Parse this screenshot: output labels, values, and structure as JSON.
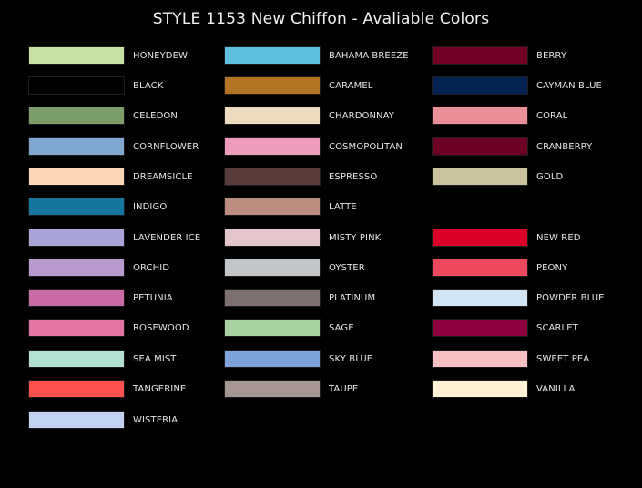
{
  "title": "STYLE 1153 New Chiffon - Avaliable Colors",
  "columns": [
    {
      "rows": [
        {
          "name": "HONEYDEW",
          "color": "#c6dfa3"
        },
        {
          "name": "BLACK",
          "color": "#000000"
        },
        {
          "name": "CELEDON",
          "color": "#7d9e6a"
        },
        {
          "name": "CORNFLOWER",
          "color": "#7fa7d0"
        },
        {
          "name": "DREAMSICLE",
          "color": "#fdd5b8"
        },
        {
          "name": "INDIGO",
          "color": "#14759f"
        },
        {
          "name": "LAVENDER ICE",
          "color": "#a9a5d8"
        },
        {
          "name": "ORCHID",
          "color": "#b89ad0"
        },
        {
          "name": "PETUNIA",
          "color": "#c96aa4"
        },
        {
          "name": "ROSEWOOD",
          "color": "#e175a4"
        },
        {
          "name": "SEA MIST",
          "color": "#b3e0cf"
        },
        {
          "name": "TANGERINE",
          "color": "#fd5150"
        },
        {
          "name": "WISTERIA",
          "color": "#c2d2f0"
        }
      ]
    },
    {
      "rows": [
        {
          "name": "BAHAMA BREEZE",
          "color": "#5cbfdd"
        },
        {
          "name": "CARAMEL",
          "color": "#b47522"
        },
        {
          "name": "CHARDONNAY",
          "color": "#eddcbd"
        },
        {
          "name": "COSMOPOLITAN",
          "color": "#ef9bbb"
        },
        {
          "name": "ESPRESSO",
          "color": "#593b3a"
        },
        {
          "name": "LATTE",
          "color": "#bc8e80"
        },
        {
          "name": "MISTY PINK",
          "color": "#e5c5cc"
        },
        {
          "name": "OYSTER",
          "color": "#c3c6c9"
        },
        {
          "name": "PLATINUM",
          "color": "#7d706f"
        },
        {
          "name": "SAGE",
          "color": "#a8d3a1"
        },
        {
          "name": "SKY BLUE",
          "color": "#7ea3d8"
        },
        {
          "name": "TAUPE",
          "color": "#a69694"
        }
      ]
    },
    {
      "rows": [
        {
          "name": "BERRY",
          "color": "#700025"
        },
        {
          "name": "CAYMAN BLUE",
          "color": "#02224f"
        },
        {
          "name": "CORAL",
          "color": "#ea8e98"
        },
        {
          "name": "CRANBERRY",
          "color": "#6e0026"
        },
        {
          "name": "GOLD",
          "color": "#cbc3a0"
        },
        {
          "name": "NEW RED",
          "color": "#db0028"
        },
        {
          "name": "PEONY",
          "color": "#ef495d"
        },
        {
          "name": "POWDER BLUE",
          "color": "#d3e6f5"
        },
        {
          "name": "SCARLET",
          "color": "#8d0040"
        },
        {
          "name": "SWEET PEA",
          "color": "#f6bfc2"
        },
        {
          "name": "VANILLA",
          "color": "#fff1d4"
        }
      ]
    }
  ]
}
